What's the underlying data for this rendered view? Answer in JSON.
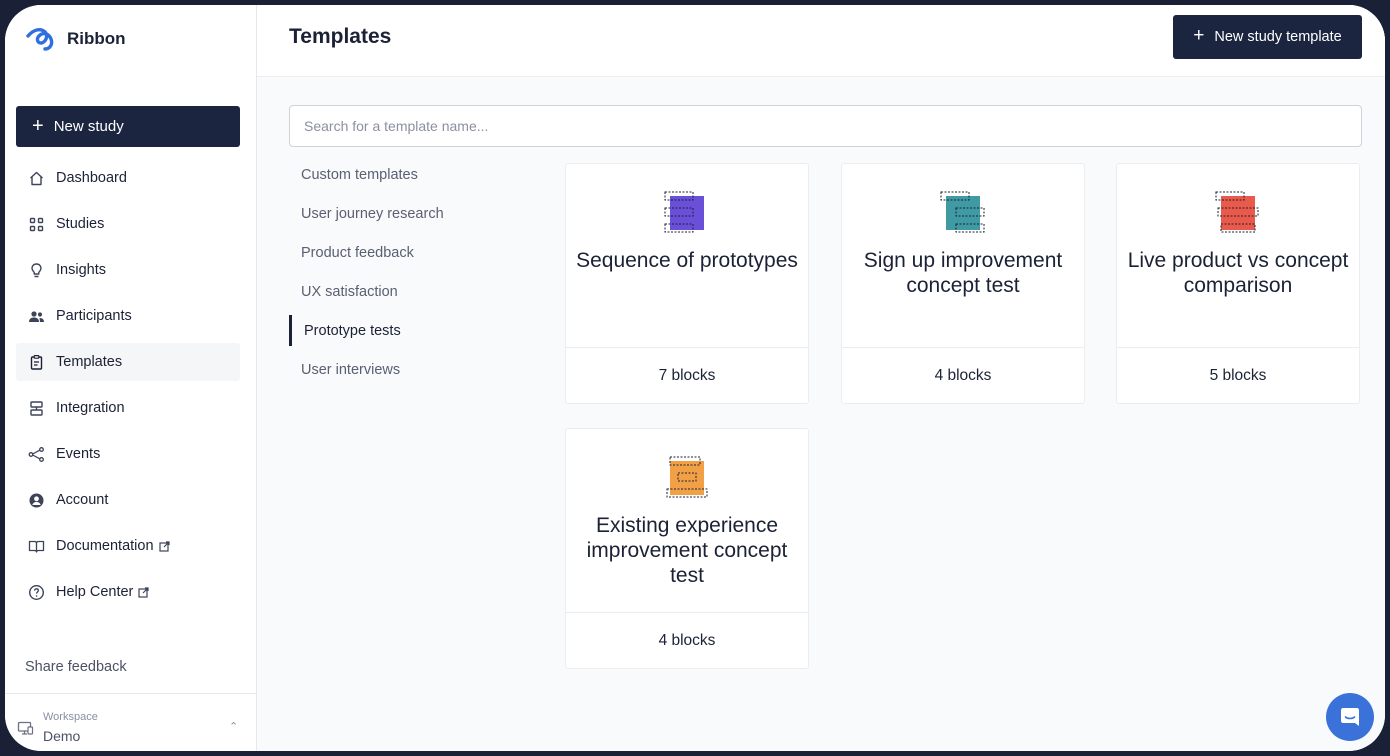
{
  "app": {
    "name": "Ribbon",
    "logo_icon": "ribbon-logo-icon",
    "accent": "#2f6fde"
  },
  "sidebar": {
    "new_study_label": "New study",
    "items": [
      {
        "label": "Dashboard",
        "icon": "home-icon"
      },
      {
        "label": "Studies",
        "icon": "grid-icon"
      },
      {
        "label": "Insights",
        "icon": "lightbulb-icon"
      },
      {
        "label": "Participants",
        "icon": "users-icon"
      },
      {
        "label": "Templates",
        "icon": "clipboard-icon",
        "active": true
      },
      {
        "label": "Integration",
        "icon": "integration-icon"
      },
      {
        "label": "Events",
        "icon": "share-nodes-icon"
      },
      {
        "label": "Account",
        "icon": "user-circle-icon"
      },
      {
        "label": "Documentation",
        "icon": "book-icon",
        "external": true
      },
      {
        "label": "Help Center",
        "icon": "help-circle-icon",
        "external": true
      }
    ],
    "share_feedback": "Share feedback",
    "workspace_label": "Workspace",
    "workspace_value": "Demo"
  },
  "header": {
    "title": "Templates",
    "new_template_label": "New study template"
  },
  "search": {
    "placeholder": "Search for a template name...",
    "value": ""
  },
  "categories": [
    {
      "label": "Custom templates"
    },
    {
      "label": "User journey research"
    },
    {
      "label": "Product feedback"
    },
    {
      "label": "UX satisfaction"
    },
    {
      "label": "Prototype tests",
      "active": true
    },
    {
      "label": "User interviews"
    }
  ],
  "templates": [
    {
      "title": "Sequence of prototypes",
      "blocks": "7 blocks",
      "color": "#6a4fd8",
      "icon": "sequence-blocks-icon"
    },
    {
      "title": "Sign up improvement concept test",
      "blocks": "4 blocks",
      "color": "#3f9aa3",
      "icon": "concept-blocks-icon"
    },
    {
      "title": "Live product vs concept comparison",
      "blocks": "5 blocks",
      "color": "#ea5a4a",
      "icon": "comparison-blocks-icon"
    },
    {
      "title": "Existing experience improvement concept test",
      "blocks": "4 blocks",
      "color": "#f1a046",
      "icon": "improvement-blocks-icon"
    }
  ],
  "chat": {
    "icon": "chat-icon",
    "color": "#3b72d9"
  }
}
